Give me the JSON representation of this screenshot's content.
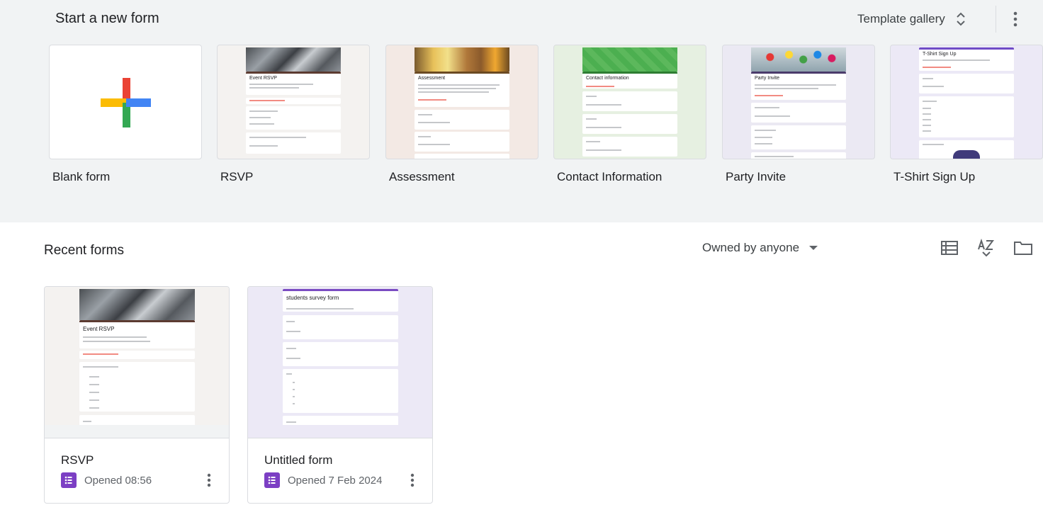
{
  "header": {
    "start_title": "Start a new form",
    "gallery_label": "Template gallery"
  },
  "templates": [
    {
      "label": "Blank form",
      "preview_title": ""
    },
    {
      "label": "RSVP",
      "preview_title": "Event RSVP"
    },
    {
      "label": "Assessment",
      "preview_title": "Assessment"
    },
    {
      "label": "Contact Information",
      "preview_title": "Contact information"
    },
    {
      "label": "Party Invite",
      "preview_title": "Party Invite"
    },
    {
      "label": "T-Shirt Sign Up",
      "preview_title": "T-Shirt Sign Up"
    }
  ],
  "recent": {
    "title": "Recent forms",
    "owner_filter": "Owned by anyone",
    "docs": [
      {
        "name": "RSVP",
        "opened": "Opened 08:56",
        "preview_title": "Event RSVP"
      },
      {
        "name": "Untitled form",
        "opened": "Opened 7 Feb 2024",
        "preview_title": "students survey form"
      }
    ]
  },
  "colors": {
    "top_bg": "#f1f3f4",
    "forms_purple": "#7c3fc4",
    "rsvp_accent": "#5c3b31",
    "assessment_bg": "#f3e9e4",
    "contact_bg": "#e6f0e1",
    "contact_green": "#4caf50",
    "party_bg": "#ebe9f3",
    "tshirt_bg": "#ece9f6",
    "survey_purple": "#7a4bc2"
  },
  "icons": {
    "gallery": "unfold-more-icon",
    "more": "more-vert-icon",
    "list_view": "list-view-icon",
    "sort": "sort-az-icon",
    "folder": "folder-icon",
    "plus": "plus-icon",
    "forms": "forms-icon"
  }
}
